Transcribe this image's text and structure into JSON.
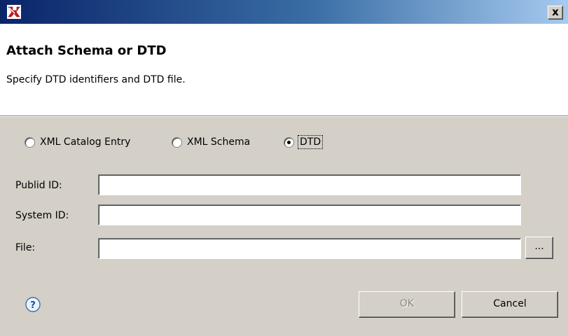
{
  "window": {
    "close_label": "x"
  },
  "header": {
    "title": "Attach Schema or DTD",
    "description": "Specify DTD identifiers and DTD file."
  },
  "options": [
    {
      "label": "XML Catalog Entry",
      "selected": false
    },
    {
      "label": "XML Schema",
      "selected": false
    },
    {
      "label": "DTD",
      "selected": true
    }
  ],
  "form": {
    "publid_label": "Publid ID:",
    "publid_value": "",
    "system_label": "System ID:",
    "system_value": "",
    "file_label": "File:",
    "file_value": "",
    "browse_label": "..."
  },
  "buttons": {
    "ok": "OK",
    "cancel": "Cancel"
  },
  "icons": {
    "app": "xml-schema-app-icon",
    "help": "help-icon"
  },
  "colors": {
    "title_gradient_start": "#0a246a",
    "title_gradient_end": "#a6caf0",
    "dialog_bg": "#d4d0c8",
    "banner_bg": "#ffffff"
  }
}
